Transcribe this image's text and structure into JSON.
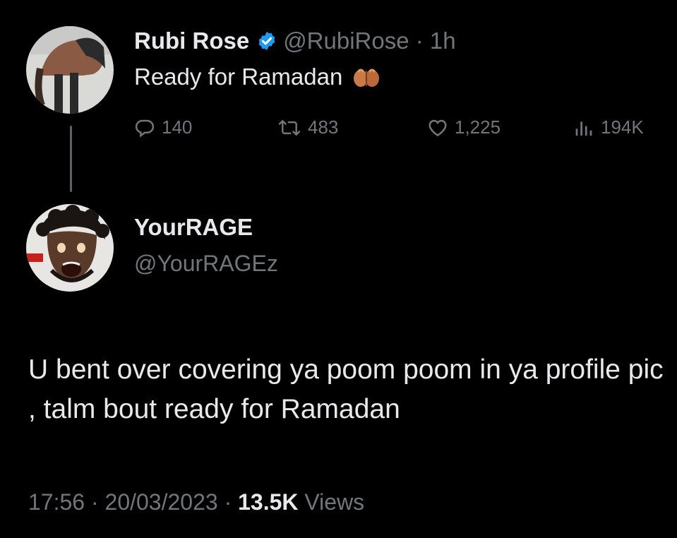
{
  "original_tweet": {
    "display_name": "Rubi Rose",
    "handle": "@RubiRose",
    "separator": " · ",
    "time_ago": "1h",
    "text": "Ready for Ramadan",
    "emoji": "folded-hands-emoji",
    "stats": {
      "replies": "140",
      "retweets": "483",
      "likes": "1,225",
      "views": "194K"
    }
  },
  "reply_tweet": {
    "display_name": "YourRAGE",
    "handle": "@YourRAGEz",
    "text": "U bent over covering ya poom poom in ya profile pic , talm bout ready for Ramadan",
    "time": "17:56",
    "separator": " · ",
    "date": "20/03/2023",
    "views_count": "13.5K",
    "views_label": "Views"
  },
  "icons": [
    "verified-badge-icon",
    "reply-icon",
    "retweet-icon",
    "like-icon",
    "views-icon"
  ],
  "colors": {
    "background": "#000000",
    "primary_text": "#e7e9ea",
    "secondary_text": "#71767b",
    "verified_blue": "#1d9bf0",
    "thread_line": "#5b6166"
  }
}
